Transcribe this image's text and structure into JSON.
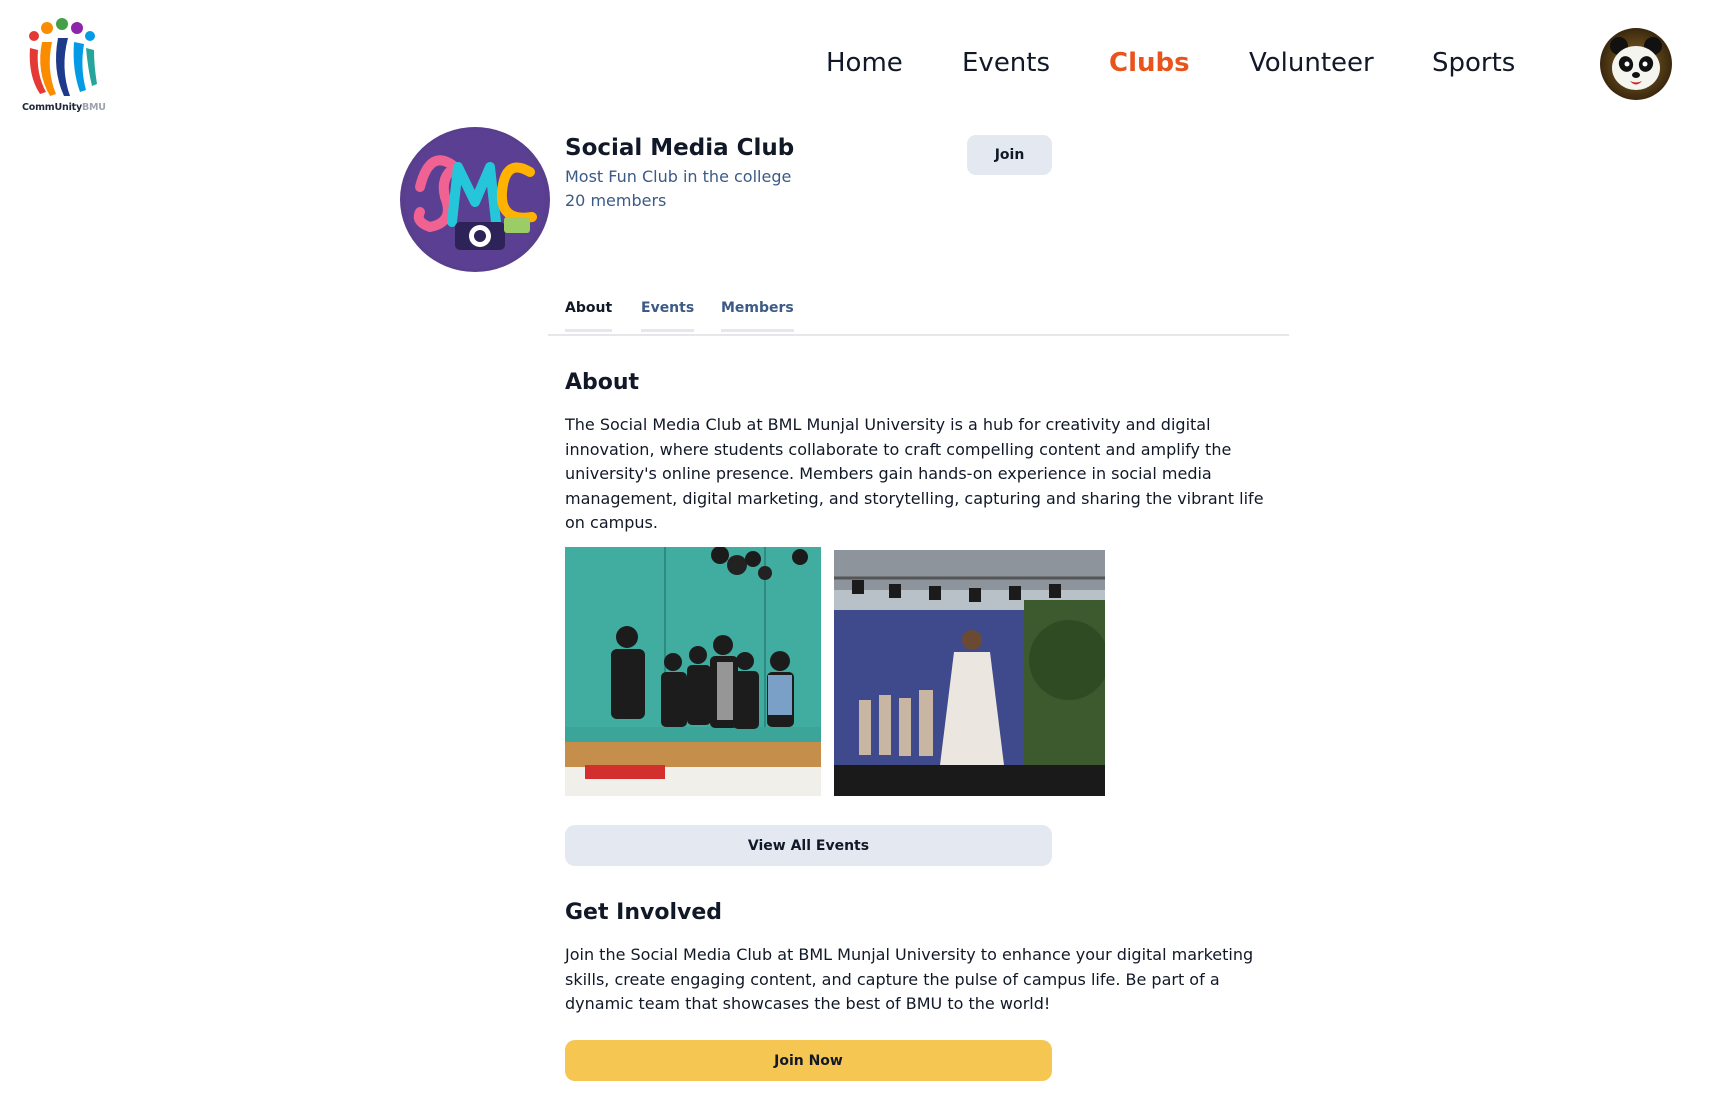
{
  "brand": {
    "name_part1": "CommUnity",
    "name_part2": "BMU"
  },
  "nav": {
    "items": [
      {
        "label": "Home"
      },
      {
        "label": "Events"
      },
      {
        "label": "Clubs"
      },
      {
        "label": "Volunteer"
      },
      {
        "label": "Sports"
      }
    ],
    "active": "Clubs",
    "active_color": "#e8541c"
  },
  "club": {
    "name": "Social Media Club",
    "tagline": "Most Fun Club in the college",
    "members": "20 members",
    "join_label": "Join"
  },
  "tabs": [
    {
      "label": "About"
    },
    {
      "label": "Events"
    },
    {
      "label": "Members"
    }
  ],
  "about": {
    "title": "About",
    "text": "The Social Media Club at BML Munjal University is a hub for creativity and digital innovation, where students collaborate to craft compelling content and amplify the university's online presence. Members gain hands-on experience in social media management, digital marketing, and storytelling, capturing and sharing the vibrant life on campus."
  },
  "view_all_label": "View All Events",
  "get_involved": {
    "title": "Get Involved",
    "text": "Join the Social Media Club at BML Munjal University to enhance your digital marketing skills, create engaging content, and capture the pulse of campus life. Be part of a dynamic team that showcases the best of BMU to the world!",
    "button_label": "Join Now"
  },
  "colors": {
    "accent": "#e8541c",
    "secondary_text": "#3b5a86",
    "button_bg": "#e4e8f1",
    "cta_bg": "#f5c652"
  }
}
